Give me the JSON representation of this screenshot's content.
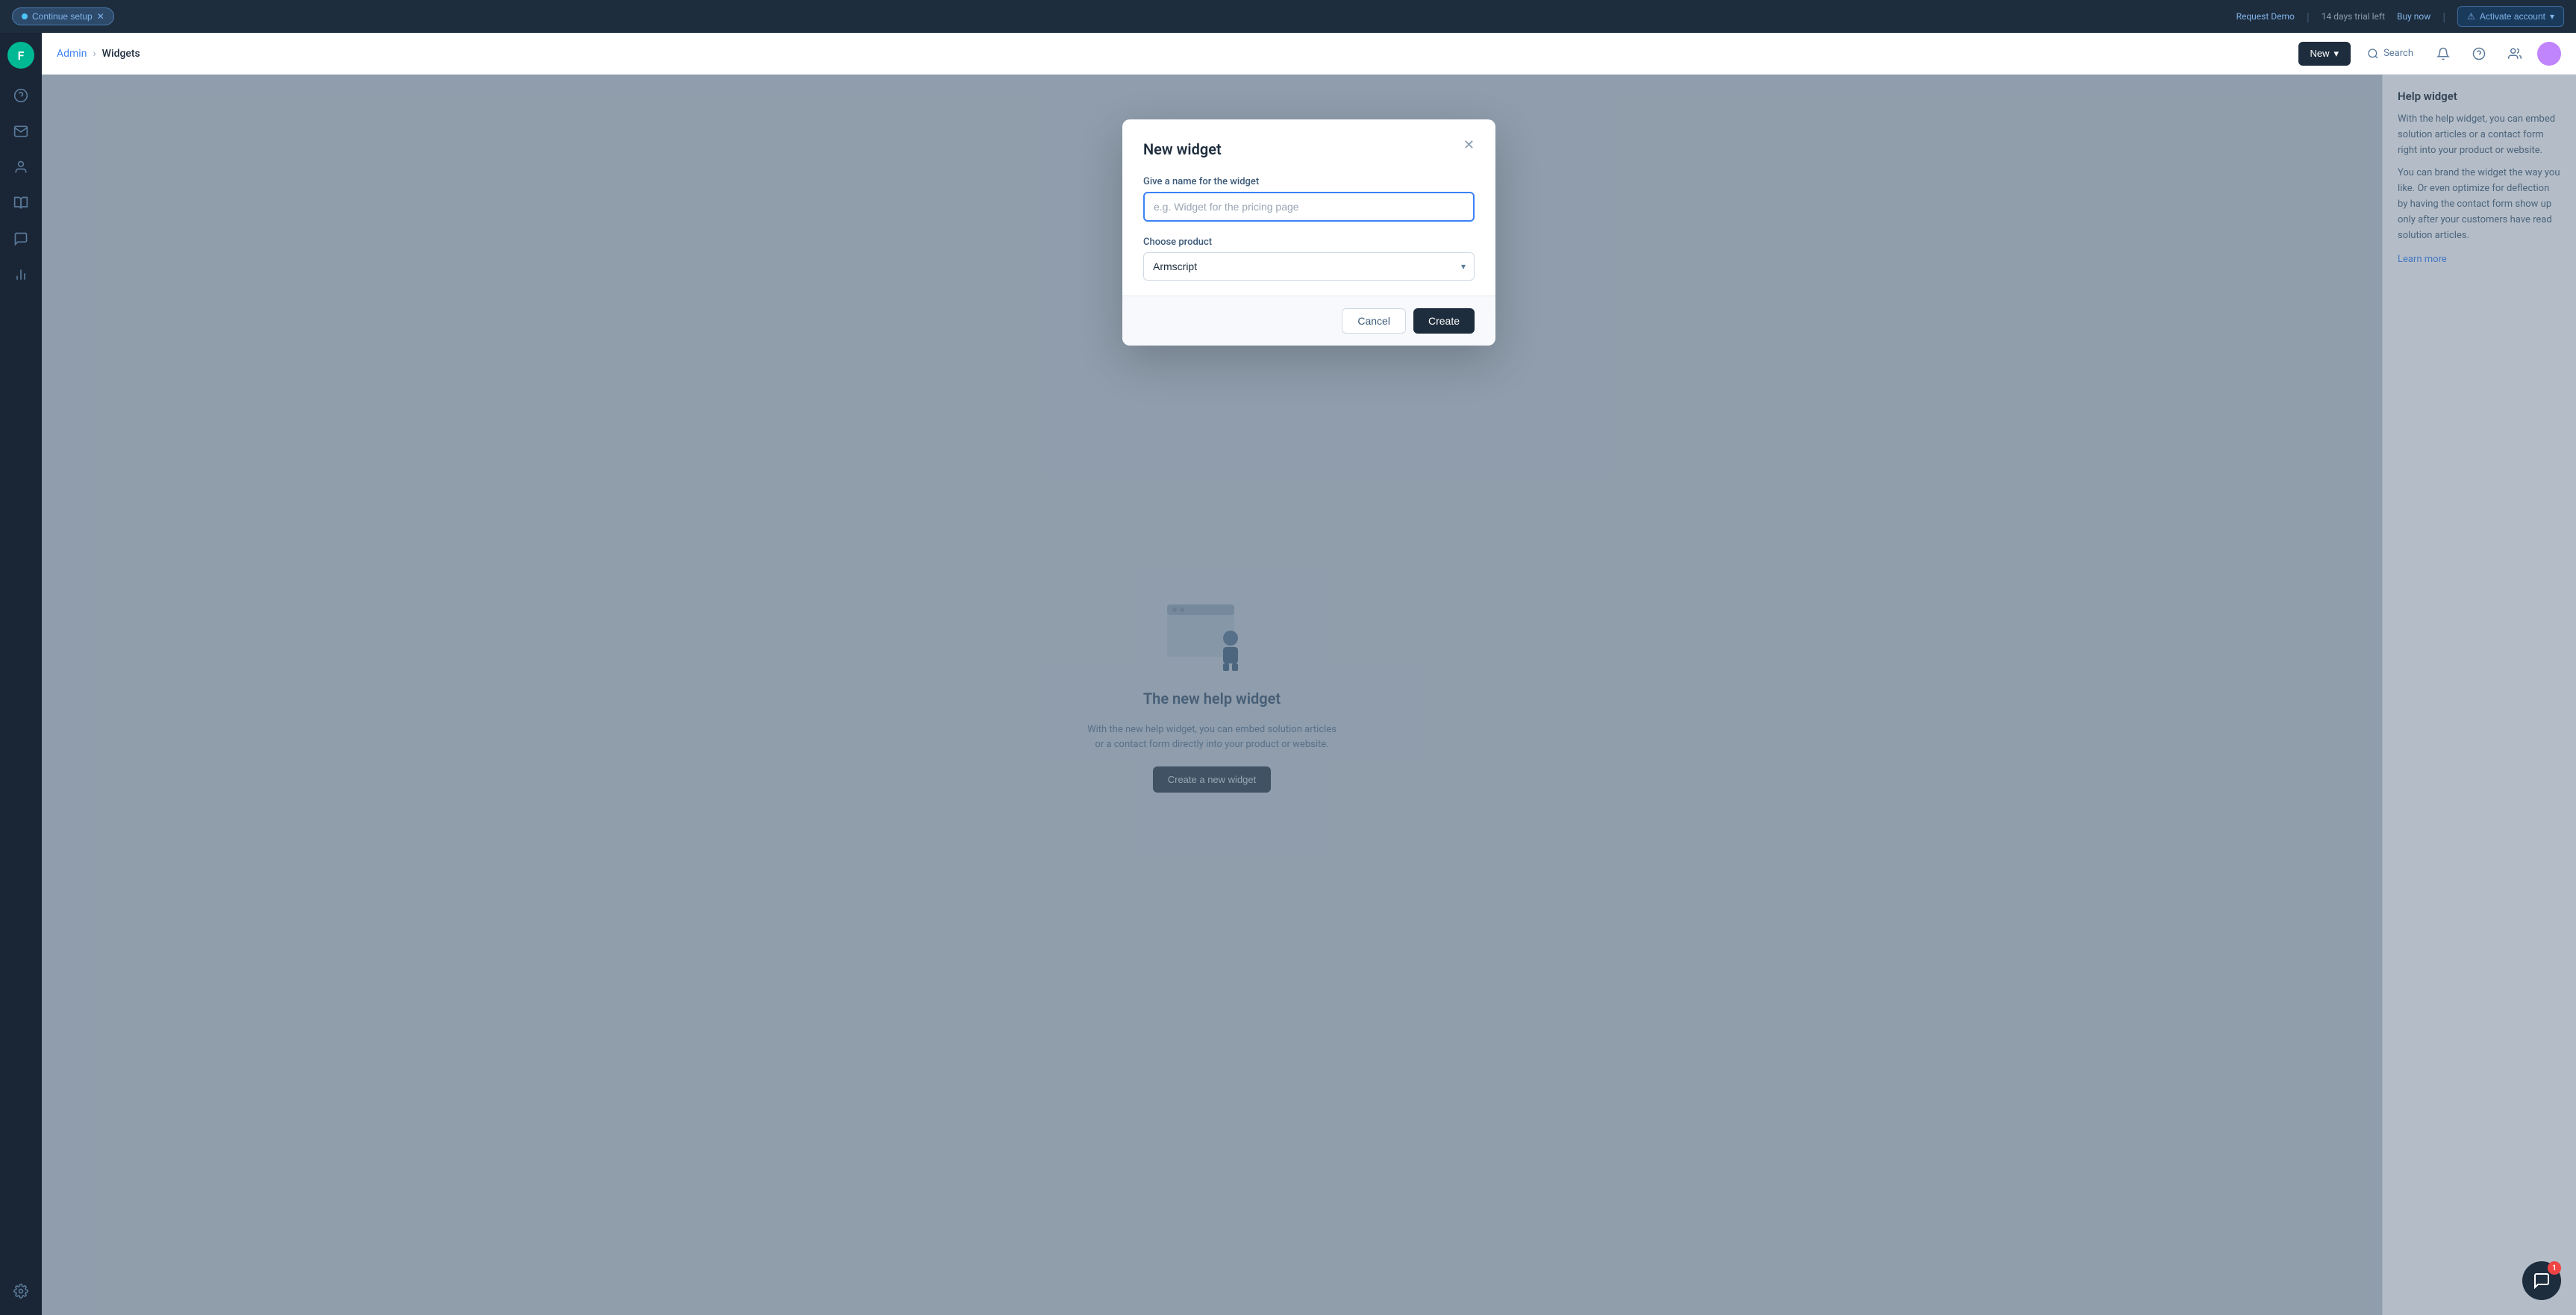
{
  "topbar": {
    "continue_setup": "Continue setup",
    "request_demo": "Request Demo",
    "trial_text": "14 days trial left",
    "buy_now": "Buy now",
    "activate_account": "Activate account"
  },
  "breadcrumb": {
    "admin": "Admin",
    "separator": "›",
    "current": "Widgets"
  },
  "header": {
    "new_label": "New",
    "search_label": "Search"
  },
  "modal": {
    "title": "New widget",
    "name_label": "Give a name for the widget",
    "name_placeholder": "e.g. Widget for the pricing page",
    "product_label": "Choose product",
    "product_value": "Armscript",
    "cancel_label": "Cancel",
    "create_label": "Create"
  },
  "right_panel": {
    "title": "Help widget",
    "para1": "With the help widget, you can embed solution articles or a contact form right into your product or website.",
    "para2": "You can brand the widget the way you like. Or even optimize for deflection by having the contact form show up only after your customers have read solution articles.",
    "learn_more": "Learn more"
  },
  "bg": {
    "title": "The new help widget",
    "subtitle": "With the new help widget, you can embed solution articles or a contact form directly into your product or website.",
    "cta": "Create a new widget"
  },
  "chat_badge": {
    "count": "1"
  }
}
